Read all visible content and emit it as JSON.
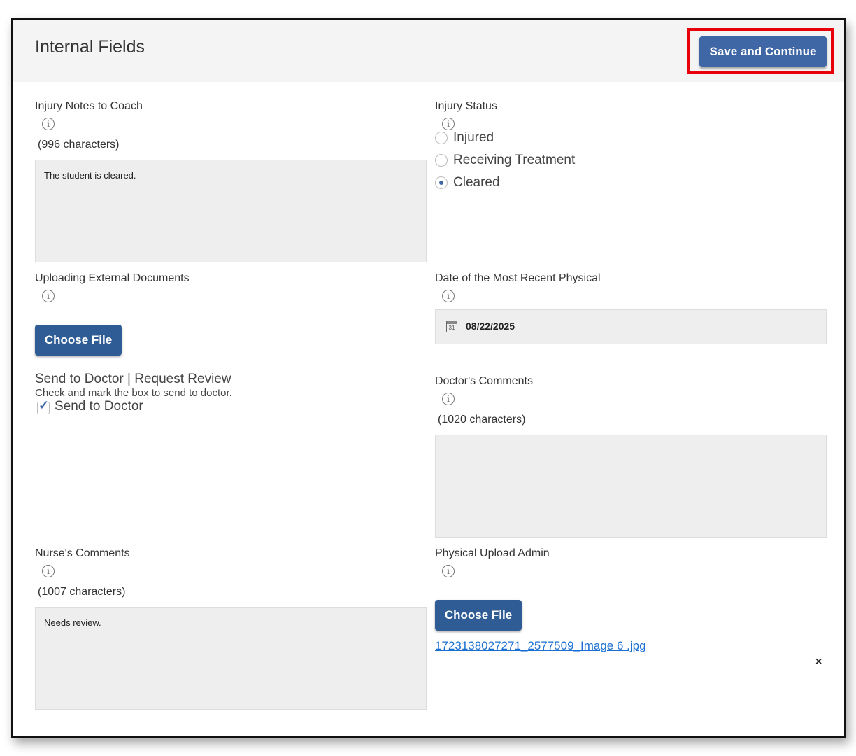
{
  "header": {
    "title": "Internal Fields",
    "save_label": "Save and Continue"
  },
  "injury_notes": {
    "label": "Injury Notes to Coach",
    "char_count": "(996 characters)",
    "value": "The student is cleared."
  },
  "injury_status": {
    "label": "Injury Status",
    "options": [
      {
        "label": "Injured",
        "selected": false
      },
      {
        "label": "Receiving Treatment",
        "selected": false
      },
      {
        "label": "Cleared",
        "selected": true
      }
    ]
  },
  "uploading": {
    "label": "Uploading External Documents",
    "button_label": "Choose File"
  },
  "physical_date": {
    "label": "Date of the Most Recent Physical",
    "value": "08/22/2025",
    "calendar_day": "31"
  },
  "send_to_doctor": {
    "title": "Send to Doctor | Request Review",
    "hint": "Check and mark the box to send to doctor.",
    "checkbox_label": "Send to Doctor",
    "checked": true
  },
  "doctor_comments": {
    "label": "Doctor's Comments",
    "char_count": "(1020 characters)",
    "value": ""
  },
  "nurse_comments": {
    "label": "Nurse's Comments",
    "char_count": "(1007 characters)",
    "value": "Needs review."
  },
  "physical_upload": {
    "label": "Physical Upload Admin",
    "button_label": "Choose File",
    "file_name": "1723138027271_2577509_Image 6 .jpg",
    "remove_label": "×"
  },
  "colors": {
    "primary_button": "#3f67a6",
    "highlight": "#e8000a",
    "link": "#1a6fd1"
  },
  "icons": [
    "info-icon",
    "calendar-icon",
    "checkmark-icon",
    "close-icon"
  ]
}
